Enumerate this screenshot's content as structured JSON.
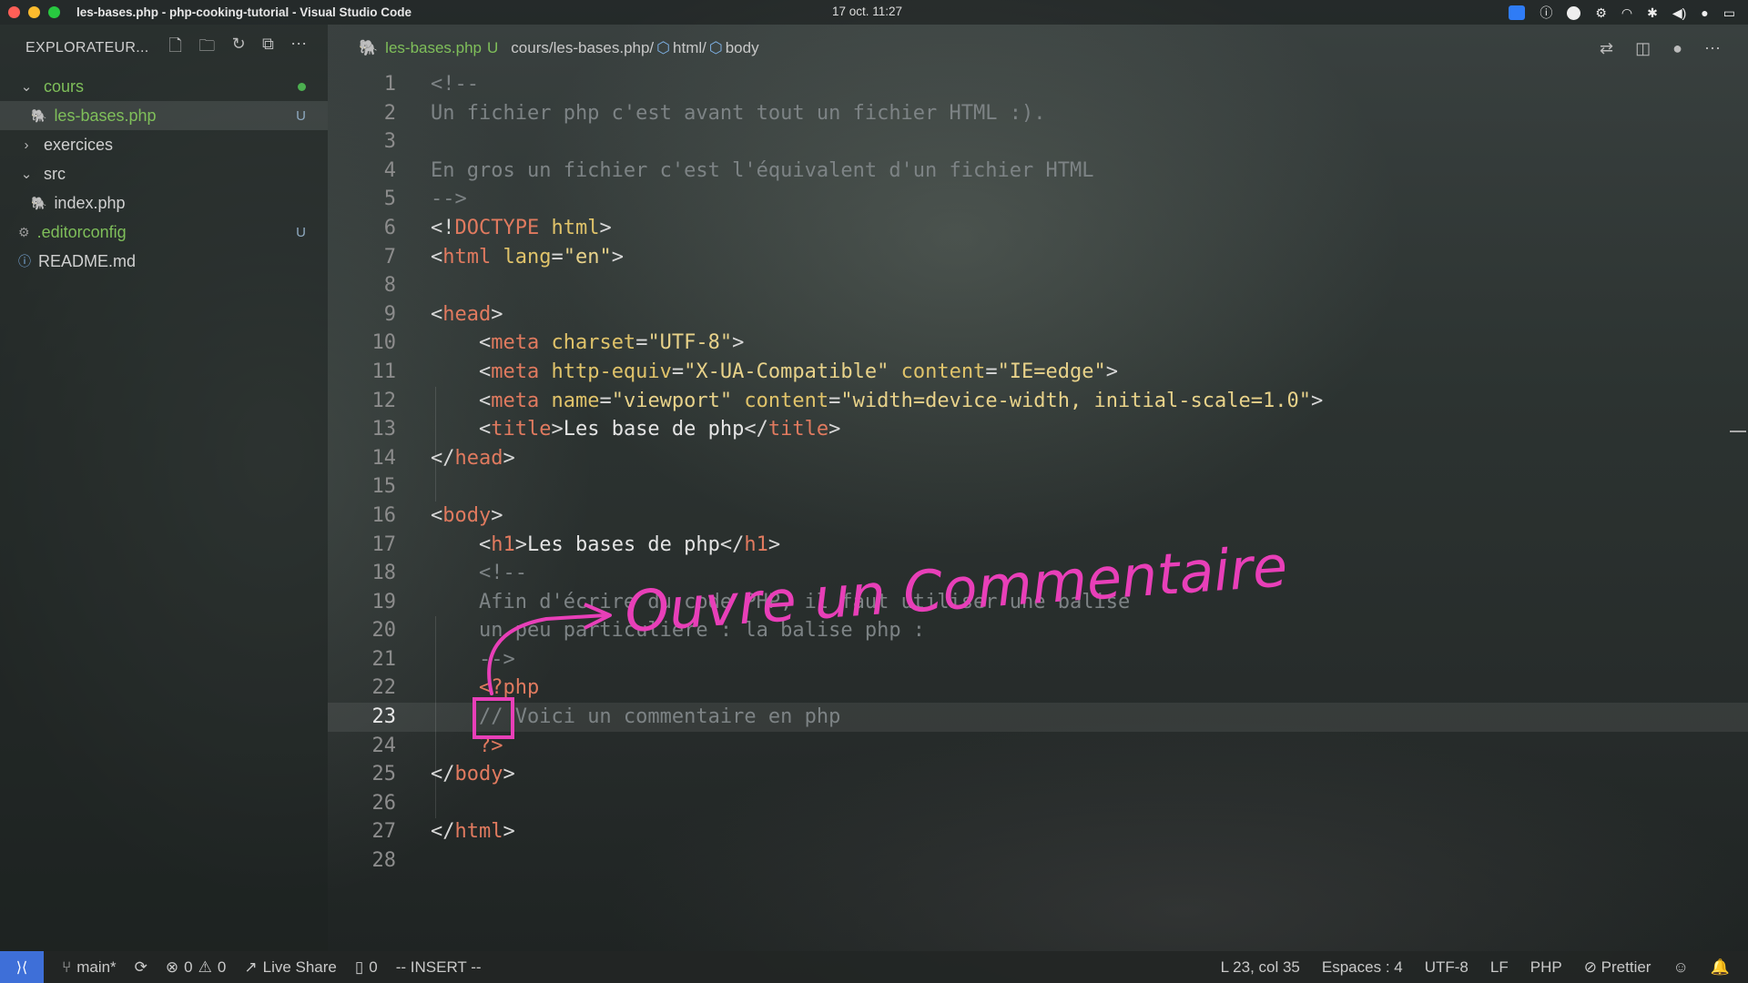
{
  "window": {
    "title": "les-bases.php - php-cooking-tutorial - Visual Studio Code",
    "clock": "17 oct. 11:27"
  },
  "sidebar": {
    "title": "EXPLORATEUR...",
    "items": [
      {
        "label": "cours",
        "type": "folder",
        "open": true,
        "indent": 0,
        "status": "dot"
      },
      {
        "label": "les-bases.php",
        "type": "php",
        "indent": 1,
        "status": "U",
        "active": true
      },
      {
        "label": "exercices",
        "type": "folder",
        "open": false,
        "indent": 0,
        "status": ""
      },
      {
        "label": "src",
        "type": "folder",
        "open": true,
        "indent": 0,
        "status": ""
      },
      {
        "label": "index.php",
        "type": "php",
        "indent": 1,
        "status": ""
      },
      {
        "label": ".editorconfig",
        "type": "config",
        "indent": 0,
        "status": "U"
      },
      {
        "label": "README.md",
        "type": "info",
        "indent": 0,
        "status": ""
      }
    ]
  },
  "breadcrumb": {
    "file": "les-bases.php",
    "status": "U",
    "path": "cours/les-bases.php/",
    "seg1": "html/",
    "seg2": "body"
  },
  "editor": {
    "current_line": 23
  },
  "annotation": {
    "text": "Ouvre un Commentaire",
    "color": "#e83fb8"
  },
  "statusbar": {
    "branch": "main*",
    "errors": "0",
    "warnings": "0",
    "live_share": "Live Share",
    "ports": "0",
    "mode": "-- INSERT --",
    "position": "L 23, col 35",
    "spaces": "Espaces : 4",
    "encoding": "UTF-8",
    "eol": "LF",
    "language": "PHP",
    "formatter": "Prettier"
  }
}
